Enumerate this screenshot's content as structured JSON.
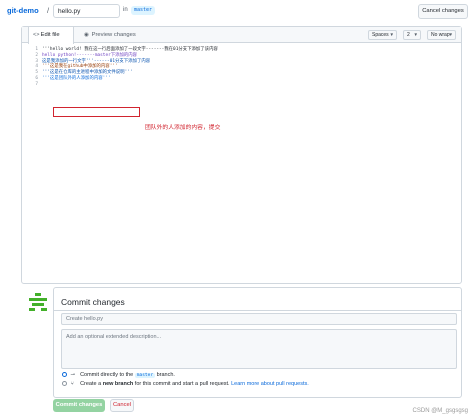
{
  "header": {
    "repo": "git-demo",
    "separator": "/",
    "filename_value": "hello.py",
    "in_label": "in",
    "branch": "master",
    "cancel_label": "Cancel changes"
  },
  "editor": {
    "tabs": [
      {
        "label": "Edit file",
        "icon": "code-icon"
      },
      {
        "label": "Preview changes",
        "icon": "eye-icon"
      }
    ],
    "indent_mode": "Spaces",
    "indent_size": "2",
    "wrap_mode": "No wrap",
    "lines": [
      {
        "n": "1",
        "text": "'''hello world! 我在这一行后面添加了一段文字-------我在01分支下添加了该内容"
      },
      {
        "n": "2",
        "text": "hello python!-------master下添加的内容"
      },
      {
        "n": "3",
        "text": "这是我添加的一行文字'''------01分支下添加了内容"
      },
      {
        "n": "4",
        "text": "'''这是我在github中添加的内容'''"
      },
      {
        "n": "5",
        "text": "'''这是在仓库的主进程中添加的文件说明'''"
      },
      {
        "n": "6",
        "text": "'''这是团队外的人添加的内容'''"
      },
      {
        "n": "7",
        "text": ""
      }
    ],
    "annotation": "团队外的人添加的内容，提交"
  },
  "commit": {
    "title": "Commit changes",
    "summary_placeholder": "Create hello.py",
    "description_placeholder": "Add an optional extended description...",
    "option_direct_pre": "Commit directly to the",
    "option_direct_branch": "master",
    "option_direct_post": "branch.",
    "option_new_pre": "Create a",
    "option_new_bold": "new branch",
    "option_new_mid": "for this commit and start a pull request.",
    "option_new_link": "Learn more about pull requests.",
    "commit_button": "Commit changes",
    "cancel_button": "Cancel"
  },
  "watermark": "CSDN @M_gsgsgsg",
  "colors": {
    "accent": "#0969da",
    "commit_green": "#94d3a2",
    "annotation_red": "#d1242f",
    "avatar_green": "#43b02a"
  }
}
